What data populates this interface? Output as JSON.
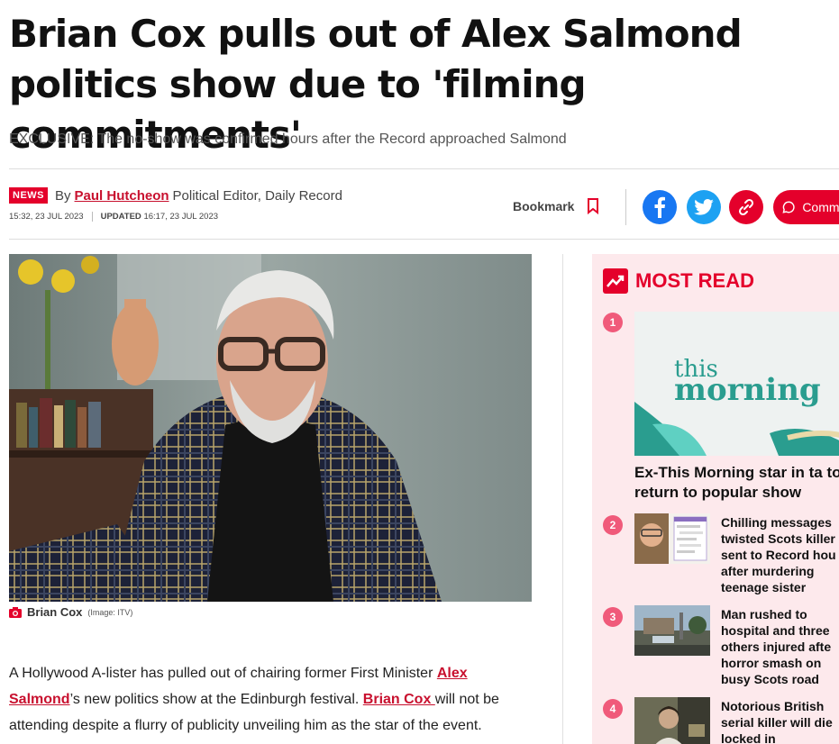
{
  "article": {
    "headline": "Brian Cox pulls out of Alex Salmond politics show due to 'filming commitments'",
    "standfirst": "EXCLUSIVE: The no-show was confirmed hours after the Record approached Salmond",
    "badge": "NEWS",
    "by": "By",
    "author": "Paul Hutcheon",
    "author_role": "Political Editor, Daily Record",
    "published": "15:32, 23 JUL 2023",
    "updated_label": "UPDATED",
    "updated": "16:17, 23 JUL 2023",
    "caption_name": "Brian Cox",
    "caption_credit": "(Image: ITV)",
    "body": {
      "p1_a": "A Hollywood A-lister has pulled out of chairing former First Minister ",
      "link1": "Alex Salmond",
      "p1_b": "’s new politics show at the Edinburgh festival. ",
      "link2": "Brian Cox ",
      "p1_c": "will not be attending despite a flurry of publicity unveiling him as the star of the event."
    }
  },
  "actions": {
    "bookmark_label": "Bookmark",
    "comment_label": "Comments"
  },
  "most_read": {
    "heading": "MOST READ",
    "hero_image_text_1": "this",
    "hero_image_text_2": "morning",
    "items": [
      {
        "rank": "1",
        "title": "Ex-This Morning star in ta to return to popular show"
      },
      {
        "rank": "2",
        "title": "Chilling messages twisted Scots killer sent to Record hou after murdering teenage sister"
      },
      {
        "rank": "3",
        "title": "Man rushed to hospital and three others injured afte horror smash on busy Scots road"
      },
      {
        "rank": "4",
        "title": "Notorious British serial killer will die locked in"
      }
    ]
  },
  "colors": {
    "brand_red": "#e4002b",
    "link_red": "#c8102e",
    "sidebar_bg": "#fde9ec",
    "facebook": "#1877f2",
    "twitter": "#1da1f2"
  }
}
